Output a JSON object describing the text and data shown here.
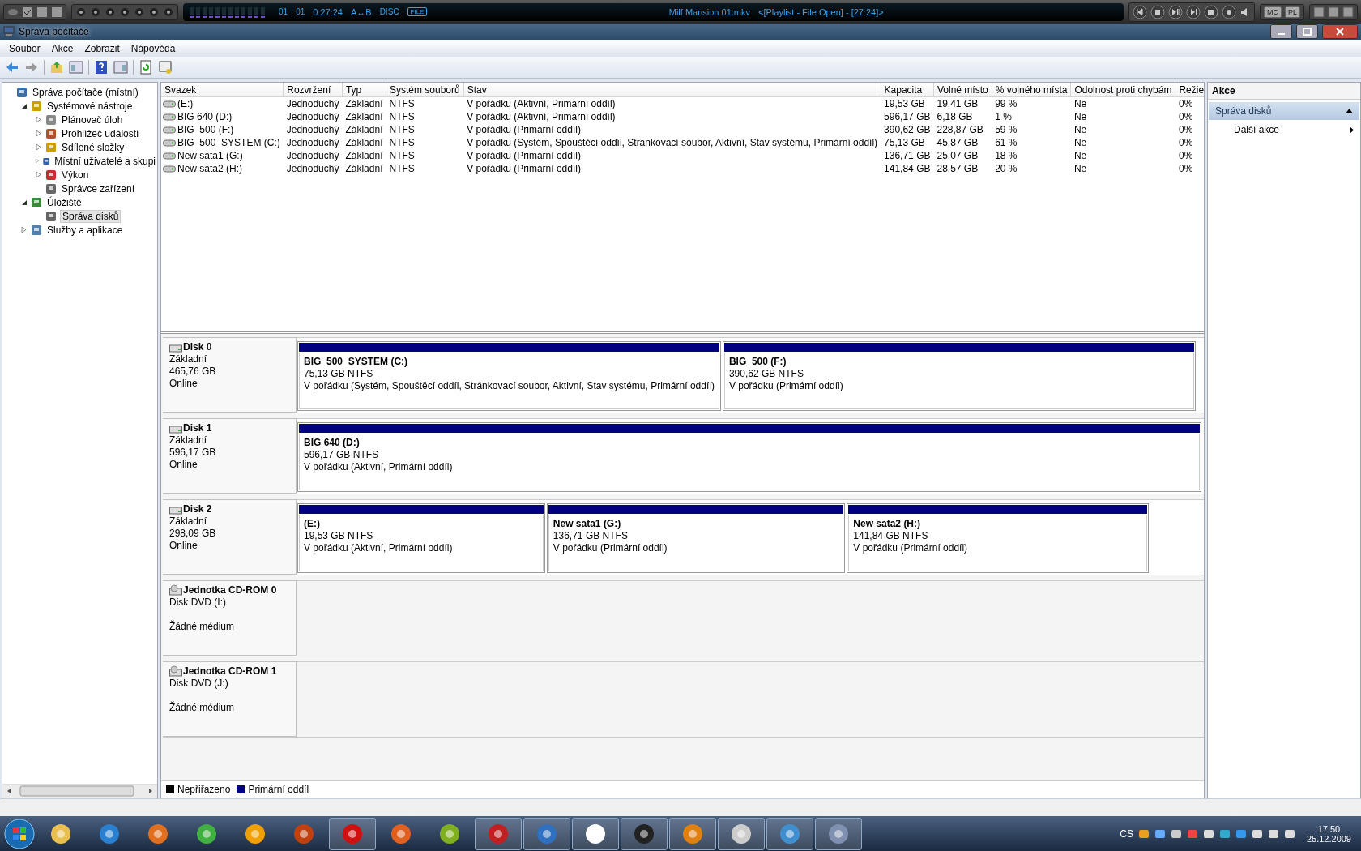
{
  "player": {
    "track": "01",
    "chapter": "01",
    "time": "0:27:24",
    "ab": "A↔B",
    "disc": "DISC",
    "file": "FILE",
    "title": "Milf Mansion 01.mkv",
    "playlist": "<[Playlist - File Open] - [27:24]>",
    "buttons": [
      "MC",
      "PL"
    ]
  },
  "window": {
    "title": "Správa počítače"
  },
  "menu": [
    "Soubor",
    "Akce",
    "Zobrazit",
    "Nápověda"
  ],
  "tree": [
    {
      "label": "Správa počítače (místní)",
      "selected": false,
      "children": [
        {
          "label": "Systémové nástroje",
          "expanded": true,
          "selected": false,
          "children": [
            {
              "label": "Plánovač úloh",
              "expanded": false,
              "selected": false
            },
            {
              "label": "Prohlížeč událostí",
              "expanded": false,
              "selected": false
            },
            {
              "label": "Sdílené složky",
              "expanded": false,
              "selected": false
            },
            {
              "label": "Místní uživatelé a skupi",
              "expanded": false,
              "selected": false
            },
            {
              "label": "Výkon",
              "expanded": false,
              "selected": false
            },
            {
              "label": "Správce zařízení",
              "selected": false
            }
          ]
        },
        {
          "label": "Úložiště",
          "expanded": true,
          "selected": false,
          "children": [
            {
              "label": "Správa disků",
              "selected": true
            }
          ]
        },
        {
          "label": "Služby a aplikace",
          "expanded": false,
          "selected": false
        }
      ]
    }
  ],
  "volumes": {
    "columns": [
      "Svazek",
      "Rozvržení",
      "Typ",
      "Systém souborů",
      "Stav",
      "Kapacita",
      "Volné místo",
      "% volného místa",
      "Odolnost proti chybám",
      "Režie"
    ],
    "rows": [
      [
        "(E:)",
        "Jednoduchý",
        "Základní",
        "NTFS",
        "V pořádku (Aktivní, Primární oddíl)",
        "19,53 GB",
        "19,41 GB",
        "99 %",
        "Ne",
        "0%"
      ],
      [
        "BIG 640 (D:)",
        "Jednoduchý",
        "Základní",
        "NTFS",
        "V pořádku (Aktivní, Primární oddíl)",
        "596,17 GB",
        "6,18 GB",
        "1 %",
        "Ne",
        "0%"
      ],
      [
        "BIG_500 (F:)",
        "Jednoduchý",
        "Základní",
        "NTFS",
        "V pořádku (Primární oddíl)",
        "390,62 GB",
        "228,87 GB",
        "59 %",
        "Ne",
        "0%"
      ],
      [
        "BIG_500_SYSTEM (C:)",
        "Jednoduchý",
        "Základní",
        "NTFS",
        "V pořádku (Systém, Spouštěcí oddíl, Stránkovací soubor, Aktivní, Stav systému, Primární oddíl)",
        "75,13 GB",
        "45,87 GB",
        "61 %",
        "Ne",
        "0%"
      ],
      [
        "New sata1 (G:)",
        "Jednoduchý",
        "Základní",
        "NTFS",
        "V pořádku (Primární oddíl)",
        "136,71 GB",
        "25,07 GB",
        "18 %",
        "Ne",
        "0%"
      ],
      [
        "New sata2 (H:)",
        "Jednoduchý",
        "Základní",
        "NTFS",
        "V pořádku (Primární oddíl)",
        "141,84 GB",
        "28,57 GB",
        "20 %",
        "Ne",
        "0%"
      ]
    ]
  },
  "disks": [
    {
      "kind": "disk",
      "name": "Disk 0",
      "type": "Základní",
      "size": "465,76 GB",
      "status": "Online",
      "partitions": [
        {
          "name": "BIG_500_SYSTEM  (C:)",
          "size": "75,13 GB NTFS",
          "status": "V pořádku (Systém, Spouštěcí oddíl, Stránkovací soubor, Aktivní, Stav systému, Primární oddíl)"
        },
        {
          "name": "BIG_500  (F:)",
          "size": "390,62 GB NTFS",
          "status": "V pořádku (Primární oddíl)"
        }
      ]
    },
    {
      "kind": "disk",
      "name": "Disk 1",
      "type": "Základní",
      "size": "596,17 GB",
      "status": "Online",
      "partitions": [
        {
          "name": "BIG 640  (D:)",
          "size": "596,17 GB NTFS",
          "status": "V pořádku (Aktivní, Primární oddíl)"
        }
      ]
    },
    {
      "kind": "disk",
      "name": "Disk 2",
      "type": "Základní",
      "size": "298,09 GB",
      "status": "Online",
      "partitions": [
        {
          "name": "(E:)",
          "size": "19,53 GB NTFS",
          "status": "V pořádku (Aktivní, Primární oddíl)"
        },
        {
          "name": "New sata1  (G:)",
          "size": "136,71 GB NTFS",
          "status": "V pořádku (Primární oddíl)"
        },
        {
          "name": "New sata2  (H:)",
          "size": "141,84 GB NTFS",
          "status": "V pořádku (Primární oddíl)"
        }
      ]
    },
    {
      "kind": "cdrom",
      "name": "Jednotka CD-ROM 0",
      "type": "Disk DVD (I:)",
      "media": "Žádné médium"
    },
    {
      "kind": "cdrom",
      "name": "Jednotka CD-ROM 1",
      "type": "Disk DVD (J:)",
      "media": "Žádné médium"
    }
  ],
  "legend": [
    {
      "label": "Nepřiřazeno",
      "color": "#000000"
    },
    {
      "label": "Primární oddíl",
      "color": "#000080"
    }
  ],
  "actions": {
    "title": "Akce",
    "section": "Správa disků",
    "expanded": true,
    "items": [
      "Další akce"
    ]
  },
  "taskbar": {
    "apps": [
      {
        "running": false
      },
      {
        "running": false
      },
      {
        "running": false
      },
      {
        "running": false
      },
      {
        "running": false
      },
      {
        "running": false
      },
      {
        "running": true
      },
      {
        "running": false
      },
      {
        "running": false
      },
      {
        "running": true
      },
      {
        "running": true
      },
      {
        "running": true
      },
      {
        "running": true
      },
      {
        "running": true
      },
      {
        "running": true
      },
      {
        "running": true
      },
      {
        "running": true
      }
    ],
    "language": "CS",
    "time": "17:50",
    "date": "25.12.2009"
  }
}
